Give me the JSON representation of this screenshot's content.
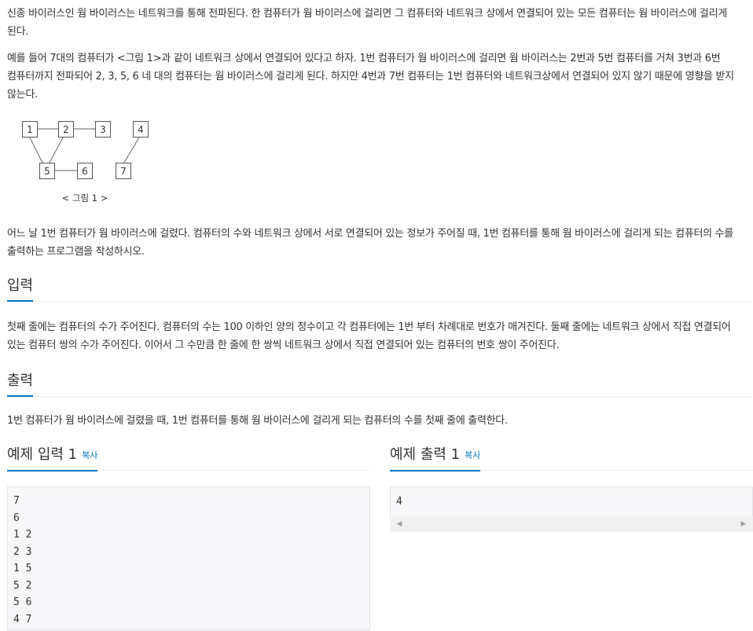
{
  "description": {
    "p1": "신종 바이러스인 웜 바이러스는 네트워크를 통해 전파된다. 한 컴퓨터가 웜 바이러스에 걸리면 그 컴퓨터와 네트워크 상에서 연결되어 있는 모든 컴퓨터는 웜 바이러스에 걸리게 된다.",
    "p2": "예를 들어 7대의 컴퓨터가 <그림 1>과 같이 네트워크 상에서 연결되어 있다고 하자. 1번 컴퓨터가 웜 바이러스에 걸리면 웜 바이러스는 2번과 5번 컴퓨터를 거쳐 3번과 6번 컴퓨터까지 전파되어 2, 3, 5, 6 네 대의 컴퓨터는 웜 바이러스에 걸리게 된다. 하지만 4번과 7번 컴퓨터는 1번 컴퓨터와 네트워크상에서 연결되어 있지 않기 때문에 영향을 받지 않는다.",
    "p3": "어느 날 1번 컴퓨터가 웜 바이러스에 걸렸다. 컴퓨터의 수와 네트워크 상에서 서로 연결되어 있는 정보가 주어질 때, 1번 컴퓨터를 통해 웜 바이러스에 걸리게 되는 컴퓨터의 수를 출력하는 프로그램을 작성하시오."
  },
  "figure": {
    "caption": "< 그림 1 >",
    "nodes": [
      "1",
      "2",
      "3",
      "4",
      "5",
      "6",
      "7"
    ]
  },
  "input": {
    "title": "입력",
    "text": "첫째 줄에는 컴퓨터의 수가 주어진다. 컴퓨터의 수는 100 이하인 양의 정수이고 각 컴퓨터에는 1번 부터 차례대로 번호가 매겨진다. 둘째 줄에는 네트워크 상에서 직접 연결되어 있는 컴퓨터 쌍의 수가 주어진다. 이어서 그 수만큼 한 줄에 한 쌍씩 네트워크 상에서 직접 연결되어 있는 컴퓨터의 번호 쌍이 주어진다."
  },
  "output": {
    "title": "출력",
    "text": "1번 컴퓨터가 웜 바이러스에 걸렸을 때, 1번 컴퓨터를 통해 웜 바이러스에 걸리게 되는 컴퓨터의 수를 첫째 줄에 출력한다."
  },
  "sample_input": {
    "title": "예제 입력 1",
    "copy_label": "복사",
    "content": "7\n6\n1 2\n2 3\n1 5\n5 2\n5 6\n4 7"
  },
  "sample_output": {
    "title": "예제 출력 1",
    "copy_label": "복사",
    "content": "4"
  },
  "colors": {
    "accent": "#0076c0",
    "text": "#333333",
    "code_bg": "#f7f7f9"
  }
}
